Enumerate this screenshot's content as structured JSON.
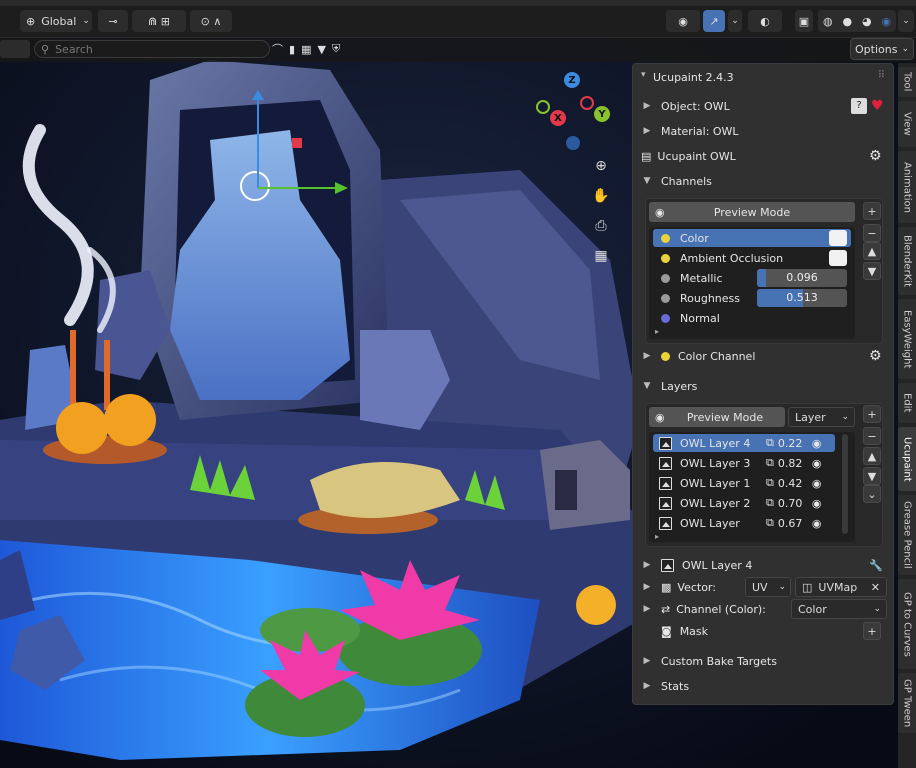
{
  "header": {
    "transform_orientation": "Global",
    "search_placeholder": "Search",
    "options_label": "Options"
  },
  "panel": {
    "title": "Ucupaint 2.4.3",
    "object_label": "Object: OWL",
    "material_label": "Material: OWL",
    "node_label": "Ucupaint OWL",
    "channels_label": "Channels",
    "preview_mode_label": "Preview Mode",
    "channels": [
      {
        "name": "Color",
        "color": "#e8d43a",
        "kind": "swatch",
        "selected": true
      },
      {
        "name": "Ambient Occlusion",
        "color": "#e8d43a",
        "kind": "swatch",
        "selected": false
      },
      {
        "name": "Metallic",
        "color": "#9a9a9a",
        "kind": "value",
        "value": "0.096",
        "fraction": 0.096
      },
      {
        "name": "Roughness",
        "color": "#9a9a9a",
        "kind": "value",
        "value": "0.513",
        "fraction": 0.513
      },
      {
        "name": "Normal",
        "color": "#6b6bd6",
        "kind": "none"
      }
    ],
    "color_channel_label": "Color Channel",
    "layers_label": "Layers",
    "layers_preview_label": "Preview Mode",
    "layers_mode_select": "Layer",
    "layers": [
      {
        "name": "OWL Layer 4",
        "opacity": "0.22",
        "selected": true
      },
      {
        "name": "OWL Layer 3",
        "opacity": "0.82",
        "selected": false
      },
      {
        "name": "OWL Layer 1",
        "opacity": "0.42",
        "selected": false
      },
      {
        "name": "OWL Layer 2",
        "opacity": "0.70",
        "selected": false
      },
      {
        "name": "OWL Layer",
        "opacity": "0.67",
        "selected": false
      }
    ],
    "active_layer_label": "OWL Layer 4",
    "vector_label": "Vector:",
    "vector_type": "UV",
    "uvmap": "UVMap",
    "channel_color_label": "Channel (Color):",
    "channel_color_value": "Color",
    "mask_label": "Mask",
    "custom_bake_label": "Custom Bake Targets",
    "stats_label": "Stats"
  },
  "gizmo": {
    "x_label": "X",
    "y_label": "Y",
    "z_label": "Z",
    "x_color": "#e23a4b",
    "y_color": "#8ac22e",
    "z_color": "#3b8be0"
  },
  "tabs": [
    "Tool",
    "View",
    "Animation",
    "BlenderKit",
    "EasyWeight",
    "Edit",
    "Ucupaint",
    "Grease Pencil",
    "GP to Curves",
    "GP Tween"
  ],
  "active_tab": "Ucupaint",
  "colors": {
    "accent": "#4772b3",
    "panel_bg": "#303030",
    "heart": "#e0203c"
  }
}
